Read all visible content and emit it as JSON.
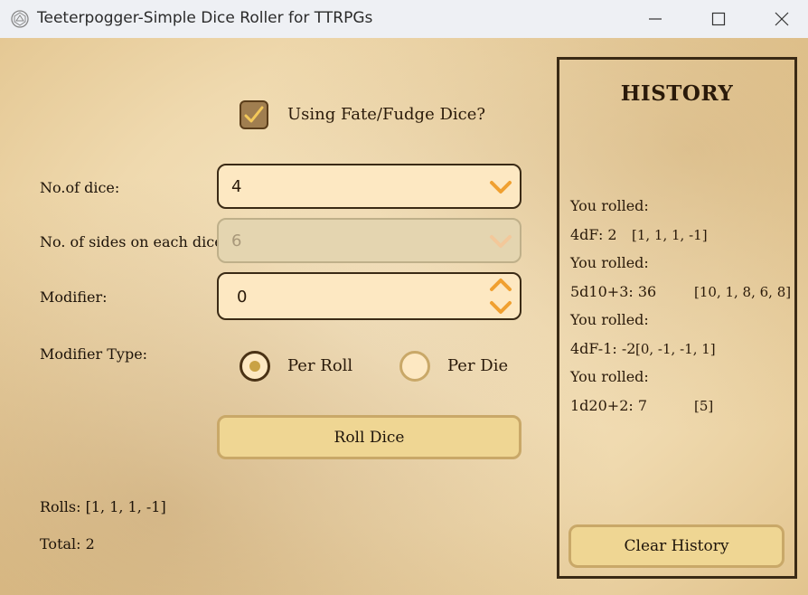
{
  "window": {
    "title": "Teeterpogger-Simple Dice Roller for TTRPGs",
    "icon": "d20-icon",
    "controls": [
      "minimize",
      "maximize",
      "close"
    ]
  },
  "fate_checkbox": {
    "label": "Using Fate/Fudge Dice?",
    "checked": true
  },
  "dice_count": {
    "label": "No.of dice:",
    "value": "4"
  },
  "dice_sides": {
    "label": "No. of sides on each dice:",
    "value": "6",
    "disabled": true
  },
  "modifier": {
    "label": "Modifier:",
    "value": "0"
  },
  "modifier_type": {
    "label": "Modifier Type:",
    "options": [
      {
        "label": "Per Roll",
        "selected": true
      },
      {
        "label": "Per Die",
        "selected": false
      }
    ]
  },
  "roll_button": {
    "label": "Roll Dice"
  },
  "result": {
    "rolls": "Rolls: [1, 1, 1, -1]",
    "total": "Total: 2"
  },
  "history": {
    "title": "HISTORY",
    "entries": [
      {
        "heading": "You rolled:",
        "formula": "4dF: 2",
        "rolls": "[1, 1, 1, -1]"
      },
      {
        "heading": "You rolled:",
        "formula": "5d10+3: 36",
        "rolls": "[10, 1, 8, 6, 8]"
      },
      {
        "heading": "You rolled:",
        "formula": "4dF-1: -2",
        "rolls": "[0, -1, -1, 1]"
      },
      {
        "heading": "You rolled:",
        "formula": "1d20+2: 7",
        "rolls": "[5]"
      }
    ],
    "clear_label": "Clear History"
  },
  "colors": {
    "field_bg": "#fde8c2",
    "button_bg": "#efd693",
    "chevron": "#f0a030",
    "border_dark": "#3a2a15"
  }
}
